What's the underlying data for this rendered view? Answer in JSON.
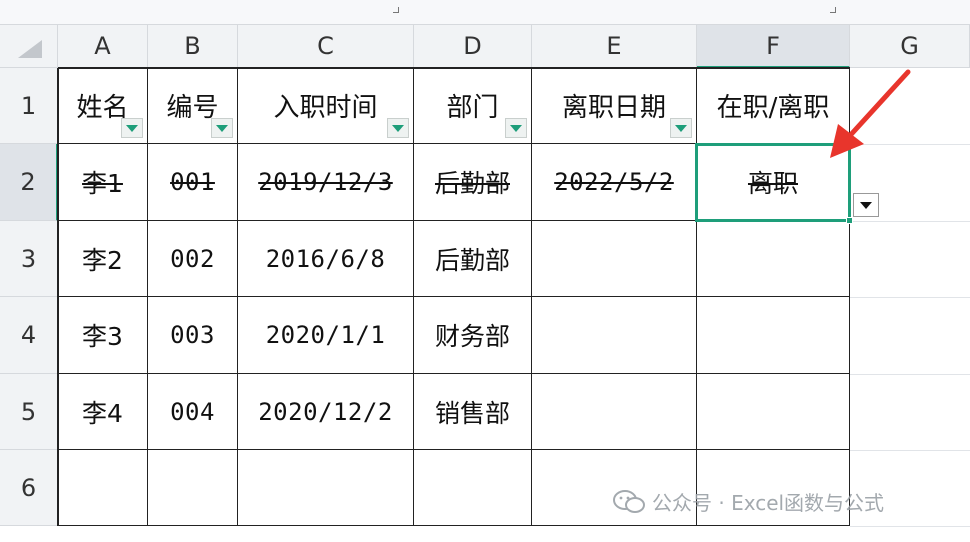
{
  "columns": [
    "A",
    "B",
    "C",
    "D",
    "E",
    "F",
    "G"
  ],
  "rows": [
    "1",
    "2",
    "3",
    "4",
    "5",
    "6"
  ],
  "header": {
    "a": "姓名",
    "b": "编号",
    "c": "入职时间",
    "d": "部门",
    "e": "离职日期",
    "f": "在职/离职"
  },
  "data_rows": [
    {
      "a": "李1",
      "b": "001",
      "c": "2019/12/3",
      "d": "后勤部",
      "e": "2022/5/2",
      "f": "离职"
    },
    {
      "a": "李2",
      "b": "002",
      "c": "2016/6/8",
      "d": "后勤部",
      "e": "",
      "f": ""
    },
    {
      "a": "李3",
      "b": "003",
      "c": "2020/1/1",
      "d": "财务部",
      "e": "",
      "f": ""
    },
    {
      "a": "李4",
      "b": "004",
      "c": "2020/12/2",
      "d": "销售部",
      "e": "",
      "f": ""
    }
  ],
  "watermark": {
    "text": "公众号 · Excel函数与公式"
  },
  "colors": {
    "accent": "#1e9e7a",
    "arrow": "#e8352c",
    "header_bg": "#f1f3f5"
  },
  "icons": [
    "filter-dropdown-icon",
    "dropdown-arrow-icon",
    "select-all-icon",
    "red-arrow-annotation",
    "wechat-icon"
  ]
}
